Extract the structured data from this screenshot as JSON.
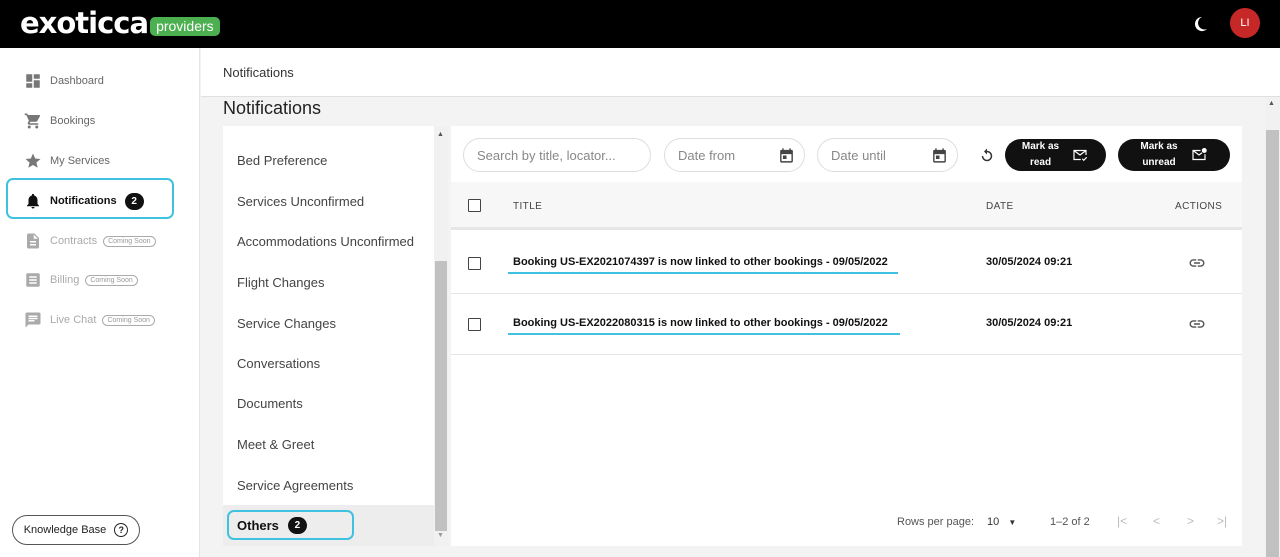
{
  "brand": {
    "logo_text": "exoticca",
    "logo_badge": "providers",
    "accent": "#4caf50",
    "avatar_initials": "LI",
    "avatar_color": "#c62828",
    "theme_icon": "moon-icon"
  },
  "sidebar": {
    "items": [
      {
        "label": "Dashboard",
        "icon": "dashboard-icon"
      },
      {
        "label": "Bookings",
        "icon": "cart-icon"
      },
      {
        "label": "My Services",
        "icon": "star-icon"
      },
      {
        "label": "Notifications",
        "icon": "bell-icon",
        "badge": "2",
        "active": true
      },
      {
        "label": "Contracts",
        "icon": "document-icon",
        "tag": "Coming Soon"
      },
      {
        "label": "Billing",
        "icon": "list-icon",
        "tag": "Coming Soon"
      },
      {
        "label": "Live Chat",
        "icon": "chat-icon",
        "tag": "Coming Soon"
      }
    ],
    "knowledge_base": "Knowledge Base"
  },
  "breadcrumb": "Notifications",
  "page_title": "Notifications",
  "categories": {
    "items": [
      "Bed Preference",
      "Services Unconfirmed",
      "Accommodations Unconfirmed",
      "Flight Changes",
      "Service Changes",
      "Conversations",
      "Documents",
      "Meet & Greet",
      "Service Agreements"
    ],
    "selected": {
      "label": "Others",
      "badge": "2"
    }
  },
  "filters": {
    "search_placeholder": "Search by title, locator...",
    "date_from_placeholder": "Date from",
    "date_until_placeholder": "Date until",
    "mark_read": {
      "line1": "Mark as",
      "line2": "read"
    },
    "mark_unread": {
      "line1": "Mark as",
      "line2": "unread"
    }
  },
  "table": {
    "headers": {
      "title": "TITLE",
      "date": "DATE",
      "actions": "ACTIONS"
    },
    "rows": [
      {
        "title": "Booking US-EX2021074397 is now linked to other bookings - 09/05/2022",
        "date": "30/05/2024 09:21"
      },
      {
        "title": "Booking US-EX2022080315 is now linked to other bookings - 09/05/2022",
        "date": "30/05/2024 09:21"
      }
    ]
  },
  "pagination": {
    "rows_per_page_label": "Rows per page:",
    "rows_per_page": "10",
    "range": "1–2 of 2"
  },
  "highlight_color": "#3fc1e0"
}
